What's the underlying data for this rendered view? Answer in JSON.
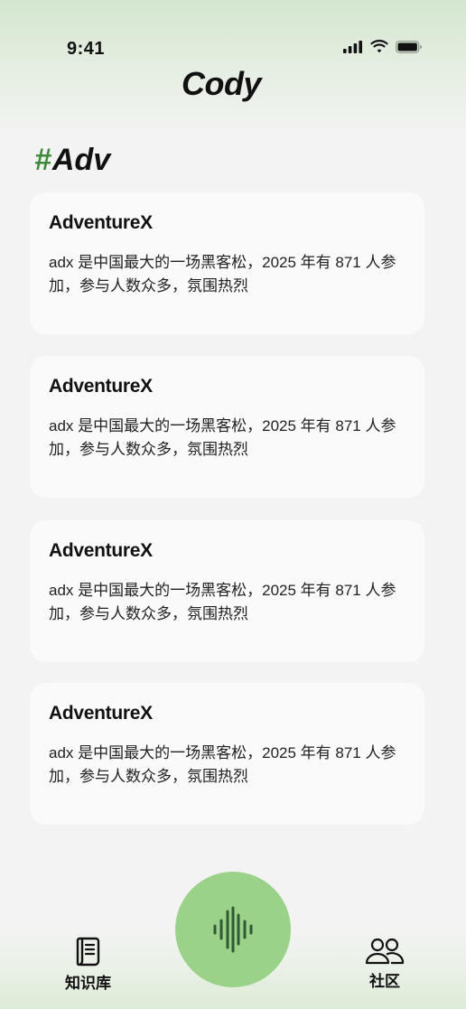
{
  "status_bar": {
    "time": "9:41",
    "icons": [
      "signal-icon",
      "wifi-icon",
      "battery-icon"
    ]
  },
  "header": {
    "app_title": "Cody"
  },
  "section": {
    "hash": "#",
    "title": "Adv"
  },
  "cards": [
    {
      "title": "AdventureX",
      "description": "adx 是中国最大的一场黑客松，2025 年有 871 人参加，参与人数众多，氛围热烈"
    },
    {
      "title": "AdventureX",
      "description": "adx 是中国最大的一场黑客松，2025 年有 871 人参加，参与人数众多，氛围热烈"
    },
    {
      "title": "AdventureX",
      "description": "adx 是中国最大的一场黑客松，2025 年有 871 人参加，参与人数众多，氛围热烈"
    },
    {
      "title": "AdventureX",
      "description": "adx 是中国最大的一场黑客松，2025 年有 871 人参加，参与人数众多，氛围热烈"
    }
  ],
  "bottom_nav": {
    "left_label": "知识库",
    "left_icon": "document-icon",
    "center_icon": "voice-waveform-icon",
    "right_label": "社区",
    "right_icon": "people-icon"
  },
  "colors": {
    "accent_green": "#9bd28a",
    "hash_green": "#3f8a3a",
    "background": "#f3f3f3",
    "card_background": "#fafafa"
  }
}
